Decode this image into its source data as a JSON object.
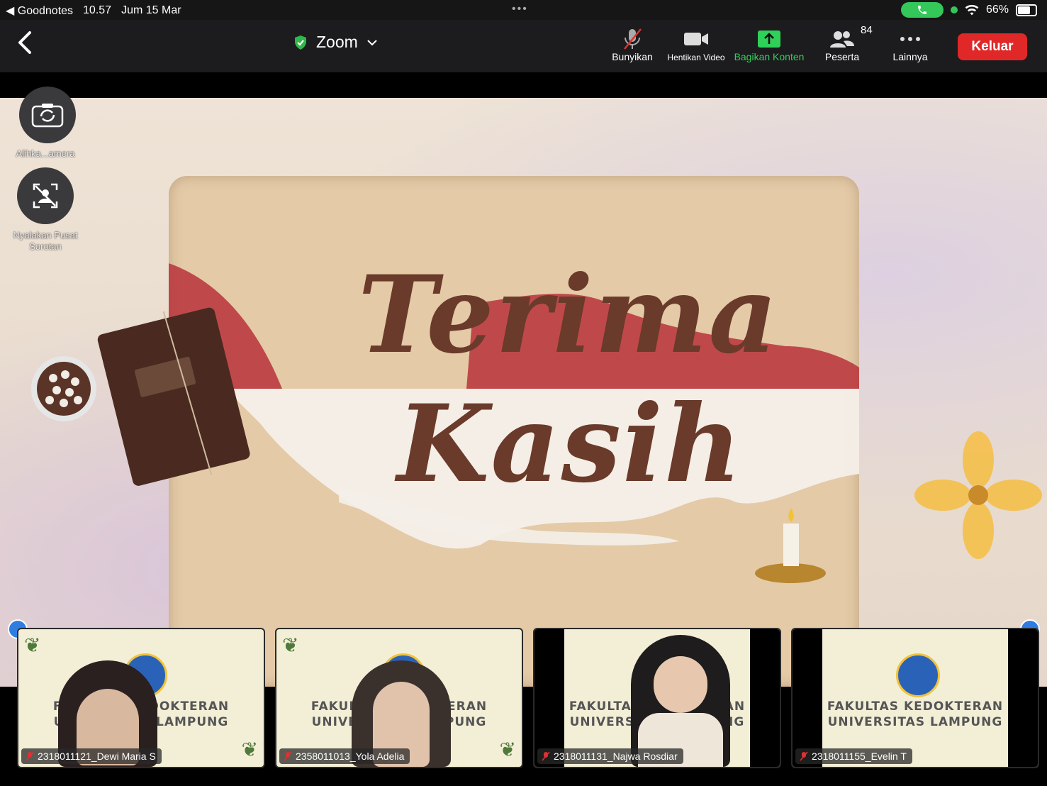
{
  "status": {
    "back_app": "◀ Goodnotes",
    "time": "10.57",
    "date": "Jum 15 Mar",
    "battery": "66%"
  },
  "header": {
    "title": "Zoom"
  },
  "toolbar": {
    "mute_label": "Bunyikan",
    "video_label": "Hentikan Video",
    "share_label": "Bagikan Konten",
    "participants_label": "Peserta",
    "participants_count": "84",
    "more_label": "Lainnya",
    "leave_label": "Keluar"
  },
  "float": {
    "switch_camera_label": "Alihka...amera",
    "spotlight_label": "Nyalakan Pusat Sorotan"
  },
  "slide": {
    "line1": "Terima",
    "line2": "Kasih"
  },
  "participants": [
    {
      "name": "2318011121_Dewi Maria S",
      "banner1": "FAKULTAS KEDOKTERAN",
      "banner2": "UNIVERSITAS LAMPUNG"
    },
    {
      "name": "2358011013_Yola Adelia",
      "banner1": "FAKULTAS KEDOKTERAN",
      "banner2": "UNIVERSITAS LAMPUNG"
    },
    {
      "name": "2318011131_Najwa Rosdiar",
      "banner1": "FAKULTAS KEDOKTERAN",
      "banner2": "UNIVERSITAS LAMPUNG"
    },
    {
      "name": "2318011155_Evelin T",
      "banner1": "FAKULTAS KEDOKTERAN",
      "banner2": "UNIVERSITAS LAMPUNG"
    }
  ]
}
